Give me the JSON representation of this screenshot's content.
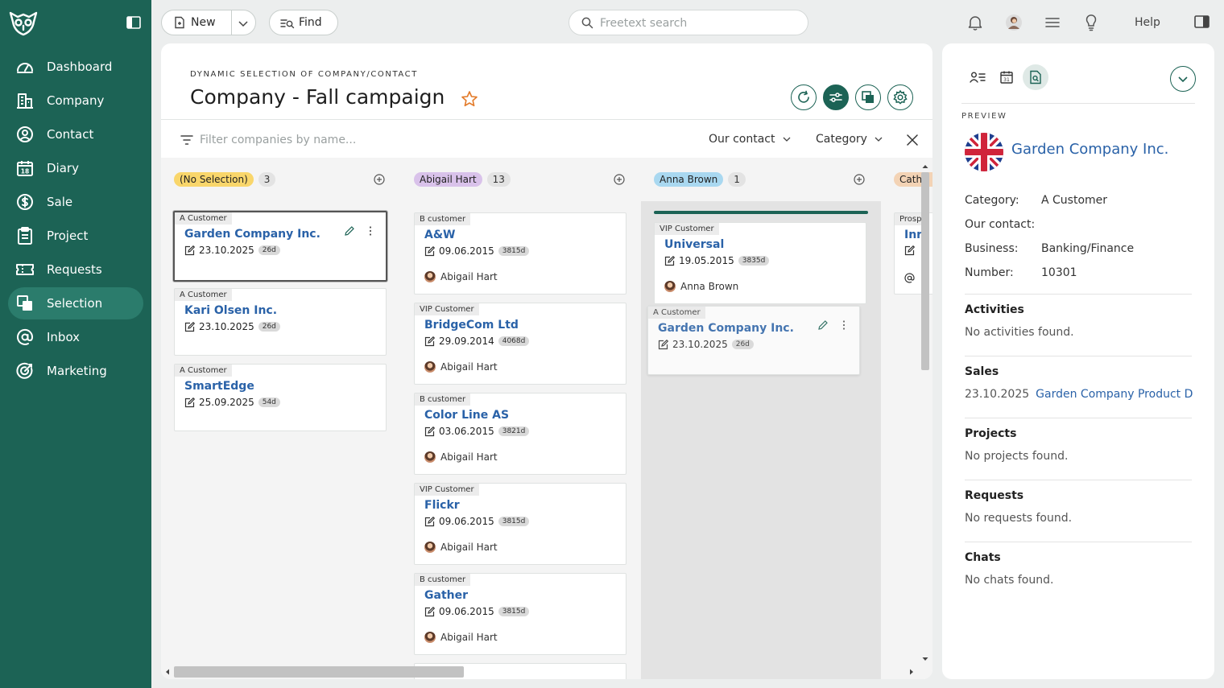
{
  "sidebar": {
    "items": [
      {
        "label": "Dashboard",
        "icon": "gauge-icon"
      },
      {
        "label": "Company",
        "icon": "building-icon"
      },
      {
        "label": "Contact",
        "icon": "person-circle-icon"
      },
      {
        "label": "Diary",
        "icon": "calendar-icon"
      },
      {
        "label": "Sale",
        "icon": "dollar-circle-icon"
      },
      {
        "label": "Project",
        "icon": "clipboard-icon"
      },
      {
        "label": "Requests",
        "icon": "ticket-icon"
      },
      {
        "label": "Selection",
        "icon": "selection-icon"
      },
      {
        "label": "Inbox",
        "icon": "at-icon"
      },
      {
        "label": "Marketing",
        "icon": "target-icon"
      }
    ],
    "active": "Selection"
  },
  "topbar": {
    "new_label": "New",
    "find_label": "Find",
    "search_placeholder": "Freetext search",
    "help_label": "Help"
  },
  "main": {
    "subtitle": "DYNAMIC SELECTION OF COMPANY/CONTACT",
    "title": "Company - Fall campaign",
    "filter_placeholder": "Filter companies by name...",
    "dropdowns": {
      "our_contact": "Our contact",
      "category": "Category"
    }
  },
  "columns": [
    {
      "label": "(No Selection)",
      "count": "3",
      "color": "#f9d66b",
      "cards": [
        {
          "category": "A Customer",
          "name": "Garden Company Inc.",
          "date": "23.10.2025",
          "age": "26d"
        },
        {
          "category": "A Customer",
          "name": "Kari Olsen Inc.",
          "date": "23.10.2025",
          "age": "26d"
        },
        {
          "category": "A Customer",
          "name": "SmartEdge",
          "date": "25.09.2025",
          "age": "54d"
        }
      ]
    },
    {
      "label": "Abigail Hart",
      "count": "13",
      "color": "#d9c2ea",
      "cards": [
        {
          "category": "B customer",
          "name": "A&W",
          "date": "09.06.2015",
          "age": "3815d",
          "owner": "Abigail Hart"
        },
        {
          "category": "VIP Customer",
          "name": "BridgeCom Ltd",
          "date": "29.09.2014",
          "age": "4068d",
          "owner": "Abigail Hart"
        },
        {
          "category": "B customer",
          "name": "Color Line AS",
          "date": "03.06.2015",
          "age": "3821d",
          "owner": "Abigail Hart"
        },
        {
          "category": "VIP Customer",
          "name": "Flickr",
          "date": "09.06.2015",
          "age": "3815d",
          "owner": "Abigail Hart"
        },
        {
          "category": "B customer",
          "name": "Gather",
          "date": "09.06.2015",
          "age": "3815d",
          "owner": "Abigail Hart"
        }
      ]
    },
    {
      "label": "Anna Brown",
      "count": "1",
      "color": "#a9d8f0",
      "cards": [
        {
          "category": "VIP Customer",
          "name": "Universal",
          "date": "19.05.2015",
          "age": "3835d",
          "owner": "Anna Brown"
        }
      ],
      "dragging": {
        "category": "A Customer",
        "name": "Garden Company Inc.",
        "date": "23.10.2025",
        "age": "26d"
      }
    },
    {
      "label": "Cath",
      "color": "#f3d3b5",
      "cards": [
        {
          "category": "Prosp",
          "name": "Inr"
        }
      ]
    }
  ],
  "preview": {
    "label": "PREVIEW",
    "name": "Garden Company Inc.",
    "fields": [
      {
        "key": "Category:",
        "value": "A Customer"
      },
      {
        "key": "Our contact:",
        "value": ""
      },
      {
        "key": "Business:",
        "value": "Banking/Finance"
      },
      {
        "key": "Number:",
        "value": "10301"
      }
    ],
    "sections": [
      {
        "title": "Activities",
        "text": "No activities found."
      },
      {
        "title": "Sales",
        "date": "23.10.2025",
        "link": "Garden Company Product D"
      },
      {
        "title": "Projects",
        "text": "No projects found."
      },
      {
        "title": "Requests",
        "text": "No requests found."
      },
      {
        "title": "Chats",
        "text": "No chats found."
      }
    ]
  },
  "colors": {
    "brand": "#1c6355",
    "link": "#2a62a8",
    "board_bg": "#f4f4f4"
  }
}
